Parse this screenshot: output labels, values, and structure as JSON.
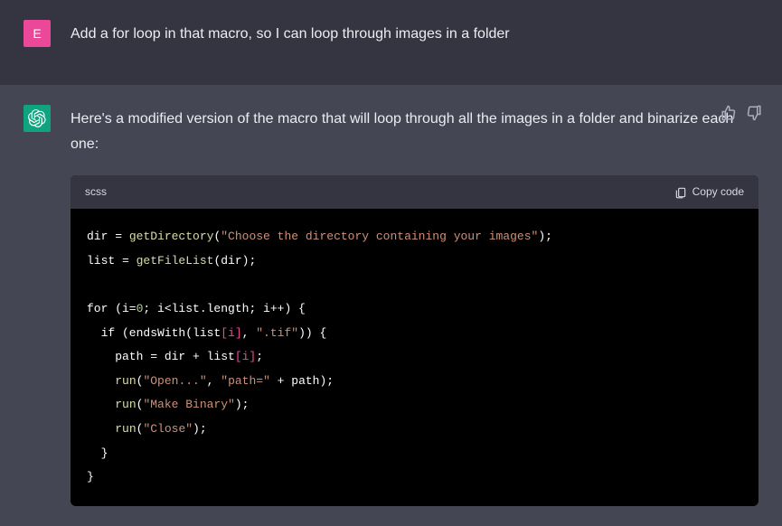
{
  "user": {
    "avatar_letter": "E",
    "message": "Add a for loop in that macro, so I can loop through images in a folder"
  },
  "assistant": {
    "message": "Here's a modified version of the macro that will loop through all the images in a folder and binarize each one:",
    "code_lang": "scss",
    "copy_label": "Copy code",
    "code": {
      "l1_a": "dir = ",
      "l1_fn": "getDirectory",
      "l1_b": "(",
      "l1_str": "\"Choose the directory containing your images\"",
      "l1_c": ");",
      "l2_a": "list = ",
      "l2_fn": "getFileList",
      "l2_b": "(dir);",
      "l3_a": "for (i=",
      "l3_num": "0",
      "l3_b": "; i<list.length; i++) {",
      "l4_a": "  if (endsWith(list",
      "l4_br1": "[i]",
      "l4_b": ", ",
      "l4_str": "\".tif\"",
      "l4_c": ")) {",
      "l5_a": "    path = dir + list",
      "l5_br": "[i]",
      "l5_b": ";",
      "l6_a": "    ",
      "l6_fn": "run",
      "l6_b": "(",
      "l6_str1": "\"Open...\"",
      "l6_c": ", ",
      "l6_str2": "\"path=\"",
      "l6_d": " + path);",
      "l7_a": "    ",
      "l7_fn": "run",
      "l7_b": "(",
      "l7_str": "\"Make Binary\"",
      "l7_c": ");",
      "l8_a": "    ",
      "l8_fn": "run",
      "l8_b": "(",
      "l8_str": "\"Close\"",
      "l8_c": ");",
      "l9": "  }",
      "l10": "}"
    }
  }
}
